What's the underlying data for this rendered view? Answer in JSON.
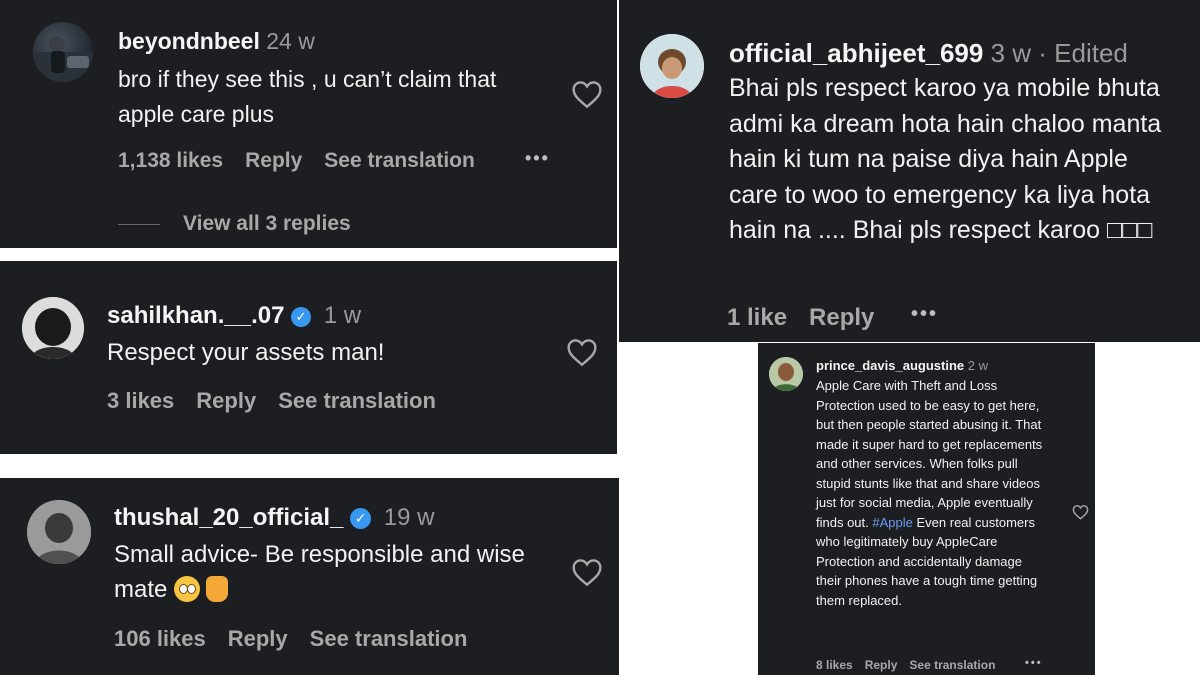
{
  "comments": [
    {
      "username": "beyondnbeel",
      "time": "24 w",
      "text": "bro if they see this , u can’t claim that apple care plus",
      "likes": "1,138 likes",
      "reply": "Reply",
      "translate": "See translation",
      "more": "•••",
      "view_replies": "View all 3 replies"
    },
    {
      "username": "official_abhijeet_699",
      "time": "3 w · Edited",
      "text": "Bhai pls respect karoo ya mobile bhuta admi ka dream hota hain chaloo manta hain ki tum na paise diya hain Apple care to woo to emergency ka liya hota hain na .... Bhai pls respect karoo □□□",
      "likes": "1 like",
      "reply": "Reply",
      "more": "•••"
    },
    {
      "username": "sahilkhan.__.07",
      "verified_mark": "✓",
      "time": "1 w",
      "text": "Respect your assets man!",
      "likes": "3 likes",
      "reply": "Reply",
      "translate": "See translation"
    },
    {
      "username": "thushal_20_official_",
      "verified_mark": "✓",
      "time": "19 w",
      "text": "Small advice- Be responsible and wise mate",
      "likes": "106 likes",
      "reply": "Reply",
      "translate": "See translation"
    },
    {
      "username": "prince_davis_augustine",
      "time": "2 w",
      "text_before": "Apple Care with Theft and Loss Protection used to be easy to get here, but then people started abusing it. That made it super hard to get replacements and other services. When folks pull stupid stunts like that and share videos just for social media, Apple eventually finds out.",
      "hashtag": "#Apple",
      "text_after": "Even real customers who legitimately buy AppleCare Protection and accidentally damage their phones have a tough time getting them replaced.",
      "likes": "8 likes",
      "reply": "Reply",
      "translate": "See translation",
      "more": "•••"
    }
  ],
  "icons": {
    "heart": "heart-outline-icon",
    "verified": "verified-badge-icon",
    "more": "more-options-icon"
  },
  "colors": {
    "card_bg": "#1c1e22",
    "verified": "#3897f0",
    "hashtag": "#6c9df2",
    "muted": "#a8a8a8"
  }
}
